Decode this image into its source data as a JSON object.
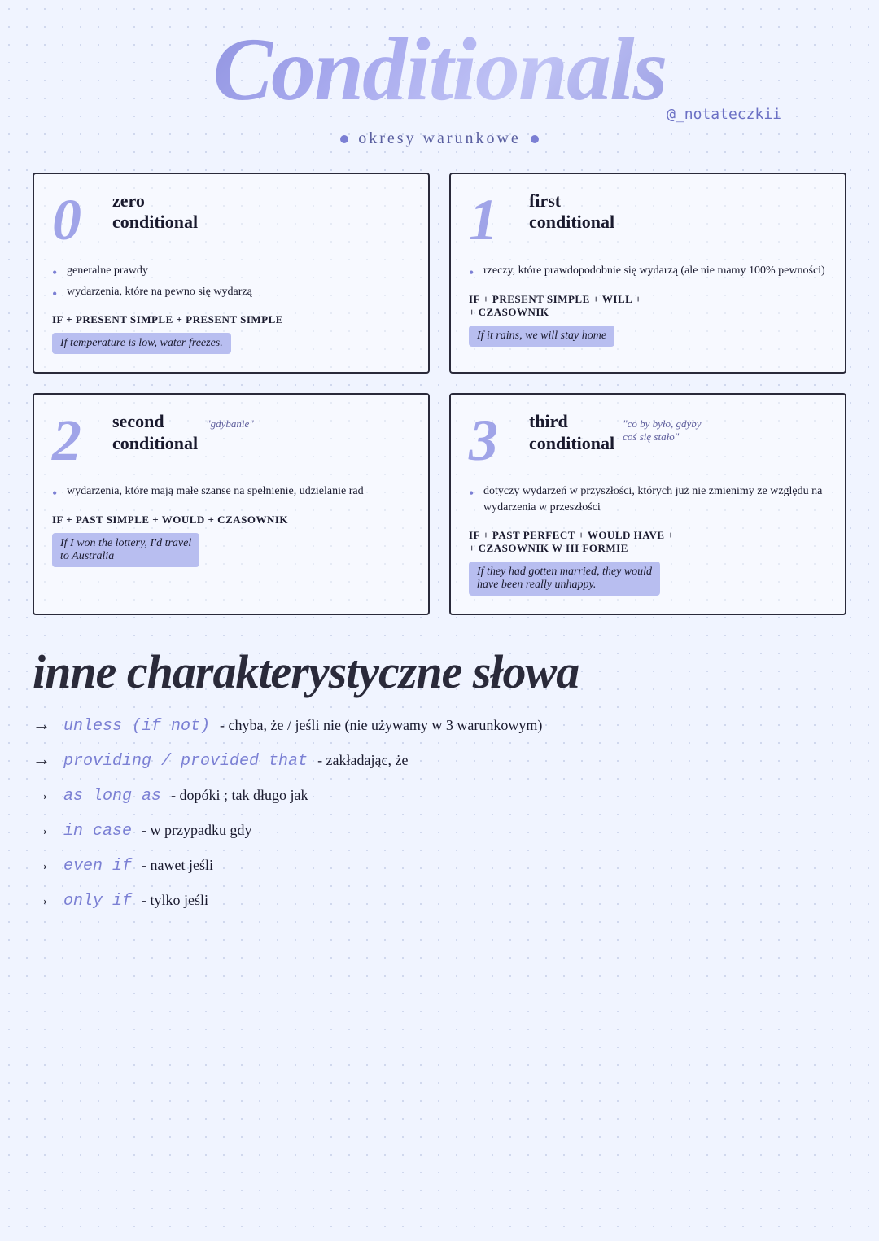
{
  "header": {
    "title": "Conditionals",
    "handle": "@_notateczkii",
    "subtitle": "okresy warunkowe"
  },
  "cards": [
    {
      "number": "0",
      "title": "zero\nconditional",
      "quote": "",
      "bullets": [
        "generalne prawdy",
        "wydarzenia, które na pewno się wydarzą"
      ],
      "formula": "IF + PRESENT SIMPLE + PRESENT SIMPLE",
      "example": "If temperature is low, water freezes."
    },
    {
      "number": "1",
      "title": "first\nconditional",
      "quote": "",
      "bullets": [
        "rzeczy, które prawdopodobnie się wydarzą (ale nie mamy 100% pewności)"
      ],
      "formula": "IF + PRESENT SIMPLE + WILL +\n+ CZASOWNIK",
      "example": "If it rains, we will stay home"
    },
    {
      "number": "2",
      "title": "second\nconditional",
      "quote": "\"gdybanie\"",
      "bullets": [
        "wydarzenia, które mają małe szanse na spełnienie, udzielanie rad"
      ],
      "formula": "IF + PAST SIMPLE + WOULD + CZASOWNIK",
      "example": "If I won the lottery, I'd travel\nto Australia"
    },
    {
      "number": "3",
      "title": "third\nconditional",
      "quote": "\"co by było, gdyby\ncoś się stało\"",
      "bullets": [
        "dotyczy wydarzeń w przyszłości, których już nie zmienimy ze względu na wydarzenia w przeszłości"
      ],
      "formula": "IF + PAST PERFECT + WOULD HAVE +\n+ CZASOWNIK W III FORMIE",
      "example": "If they had gotten married, they would\nhave been really unhappy."
    }
  ],
  "inne_section": {
    "title": "inne charakterystyczne słowa",
    "items": [
      {
        "keyword": "unless (if not)",
        "text": "- chyba, że / jeśli nie   (nie używamy w 3 warunkowym)"
      },
      {
        "keyword": "providing / provided that",
        "text": "- zakładając, że"
      },
      {
        "keyword": "as long as",
        "text": "- dopóki ; tak długo jak"
      },
      {
        "keyword": "in case",
        "text": "- w przypadku gdy"
      },
      {
        "keyword": "even if",
        "text": "- nawet jeśli"
      },
      {
        "keyword": "only if",
        "text": "- tylko jeśli"
      }
    ]
  }
}
